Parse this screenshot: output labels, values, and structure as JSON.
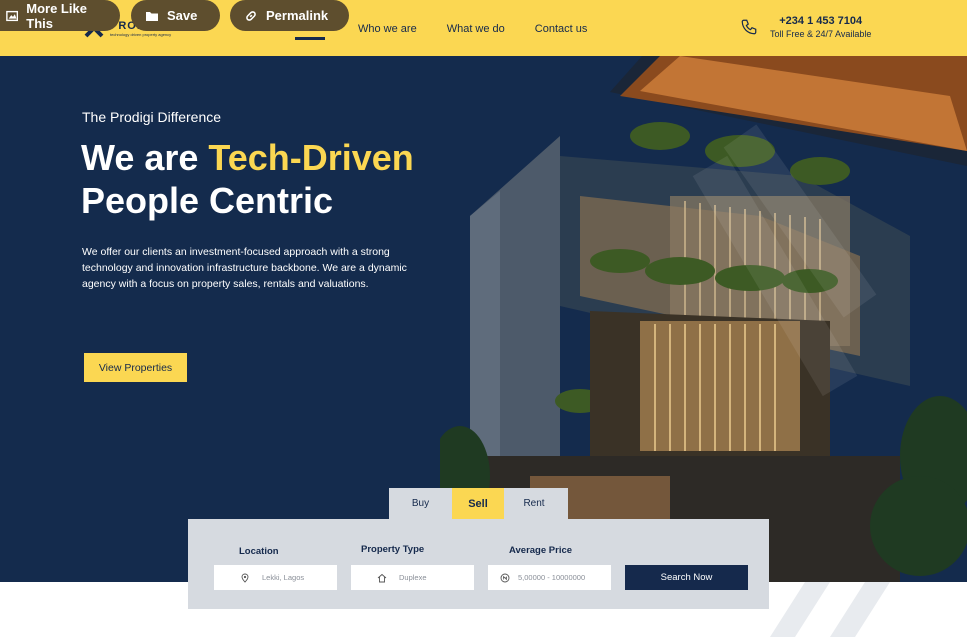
{
  "toolbar": {
    "more_like_this": "More Like This",
    "save": "Save",
    "permalink": "Permalink"
  },
  "brand": {
    "name": "PRODIGI",
    "tagline": "technology driven property agency"
  },
  "nav": {
    "items": [
      "Who we are",
      "What we do",
      "Contact us"
    ]
  },
  "contact": {
    "phone": "+234 1 453 7104",
    "availability": "Toll Free & 24/7 Available"
  },
  "hero": {
    "eyebrow": "The Prodigi Difference",
    "headline_part1": "We are ",
    "headline_accent": "Tech-Driven",
    "headline_line2": "People Centric",
    "description": "We offer our clients an investment-focused approach with a strong technology and innovation infrastructure backbone. We are a dynamic agency with a focus on property sales, rentals and valuations.",
    "cta": "View Properties"
  },
  "search": {
    "tabs": [
      "Buy",
      "Sell",
      "Rent"
    ],
    "active_tab": "Sell",
    "location_label": "Location",
    "location_value": "Lekki, Lagos",
    "property_type_label": "Property Type",
    "property_type_value": "Duplexe",
    "price_label": "Average Price",
    "price_value": "5,00000 - 10000000",
    "button": "Search Now"
  },
  "colors": {
    "brand_yellow": "#fbd752",
    "navy": "#142b4d",
    "panel_gray": "#d6dae0"
  }
}
